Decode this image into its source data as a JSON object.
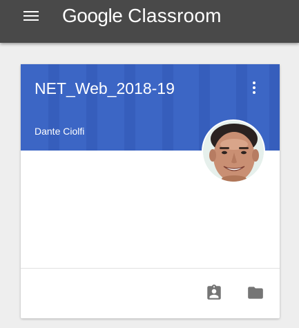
{
  "app": {
    "brand_google": "Google",
    "brand_product": "Classroom"
  },
  "icons": {
    "menu": "hamburger-menu-icon",
    "more": "more-vert-icon",
    "assignment": "assignment-ind-icon",
    "folder": "folder-icon"
  },
  "colors": {
    "topbar": "#494949",
    "course_header": "#3c66c5",
    "footer_icons": "#757575"
  },
  "course_card": {
    "title": "NET_Web_2018-19",
    "teacher": "Dante Ciolfi"
  }
}
